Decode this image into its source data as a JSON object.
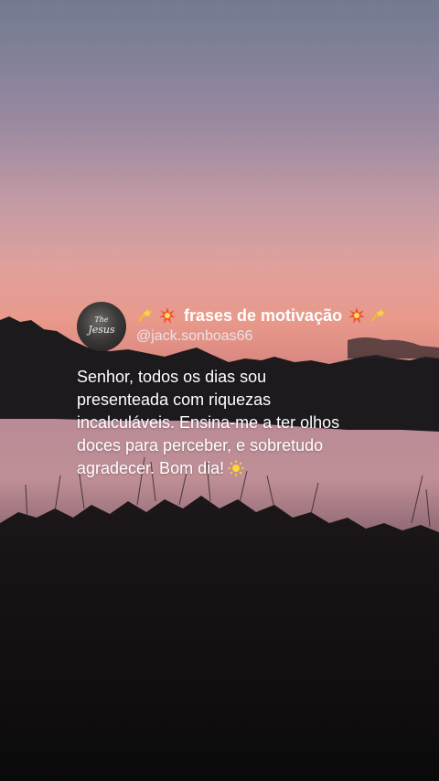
{
  "post": {
    "display_name": "frases de motivação",
    "handle": "@jack.sonboas66",
    "avatar_text_top": "The",
    "avatar_text_main": "Jesus",
    "body_lines": [
      "Senhor, todos os dias sou",
      "presenteada com riquezas",
      "incalculáveis. Ensina-me a ter olhos",
      "doces para perceber, e sobretudo",
      "agradecer. Bom dia!"
    ],
    "name_prefix_icons": [
      "dizzy-icon",
      "collision-icon"
    ],
    "name_suffix_icons": [
      "collision-icon",
      "dizzy-icon"
    ],
    "body_suffix_icon": "sun-icon"
  },
  "colors": {
    "sky_top": "#737a8f",
    "sky_horizon": "#e9998a",
    "ground": "#0e0c0d",
    "water": "#b88994",
    "text": "#ffffff"
  }
}
